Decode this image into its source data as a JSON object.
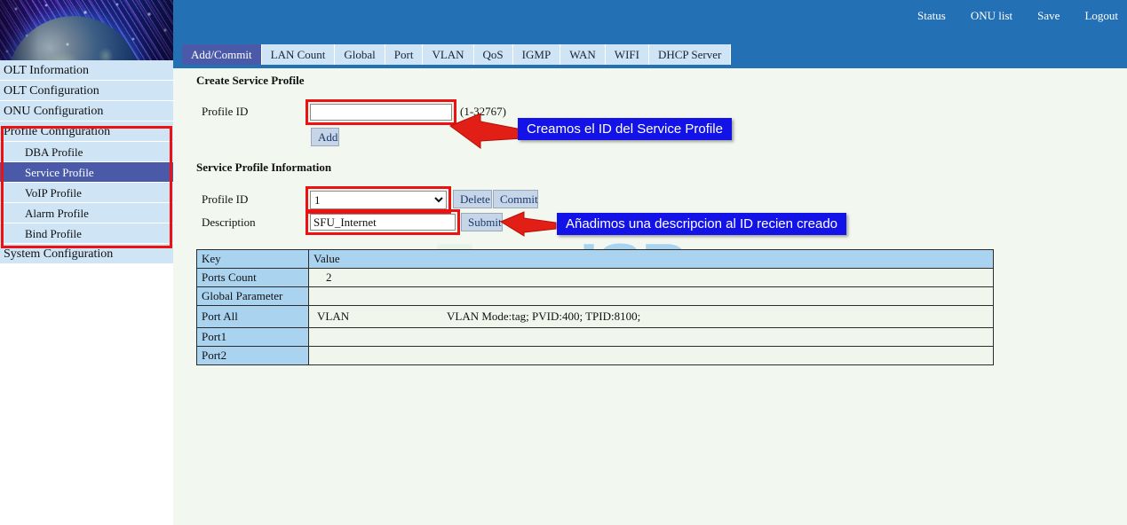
{
  "colors": {
    "header_blue": "#2470b4",
    "tab_active": "#4a5aa8",
    "tab_idle": "#cfe4f5",
    "sidebar_item": "#cfe4f5",
    "sidebar_active": "#4a5aa8",
    "content_bg": "#f2f7ef",
    "table_header": "#aad3f0",
    "annotation_red": "#ee1111",
    "callout_blue": "#1313e8"
  },
  "banner": {
    "alt": "globe-network-banner"
  },
  "sidebar": {
    "items": [
      {
        "label": "OLT Information",
        "level": 0,
        "active": false
      },
      {
        "label": "OLT Configuration",
        "level": 0,
        "active": false
      },
      {
        "label": "ONU Configuration",
        "level": 0,
        "active": false
      },
      {
        "label": "Profile Configuration",
        "level": 0,
        "active": false
      },
      {
        "label": "DBA Profile",
        "level": 1,
        "active": false
      },
      {
        "label": "Service Profile",
        "level": 1,
        "active": true
      },
      {
        "label": "VoIP Profile",
        "level": 1,
        "active": false
      },
      {
        "label": "Alarm Profile",
        "level": 1,
        "active": false
      },
      {
        "label": "Bind Profile",
        "level": 1,
        "active": false
      },
      {
        "label": "System Configuration",
        "level": 0,
        "active": false
      }
    ]
  },
  "topnav": {
    "links": [
      {
        "label": "Status"
      },
      {
        "label": "ONU list"
      },
      {
        "label": "Save"
      },
      {
        "label": "Logout"
      }
    ]
  },
  "tabs": [
    {
      "label": "Add/Commit",
      "active": true
    },
    {
      "label": "LAN Count",
      "active": false
    },
    {
      "label": "Global",
      "active": false
    },
    {
      "label": "Port",
      "active": false
    },
    {
      "label": "VLAN",
      "active": false
    },
    {
      "label": "QoS",
      "active": false
    },
    {
      "label": "IGMP",
      "active": false
    },
    {
      "label": "WAN",
      "active": false
    },
    {
      "label": "WIFI",
      "active": false
    },
    {
      "label": "DHCP Server",
      "active": false
    }
  ],
  "create_section": {
    "title": "Create Service Profile",
    "profile_id_label": "Profile ID",
    "profile_id_value": "",
    "profile_id_placeholder": "",
    "range_hint": "(1-32767)",
    "add_button": "Add"
  },
  "info_section": {
    "title": "Service Profile Information",
    "profile_id_label": "Profile ID",
    "profile_id_selected": "1",
    "profile_id_options": [
      "1"
    ],
    "delete_button": "Delete",
    "commit_button": "Commit",
    "description_label": "Description",
    "description_value": "SFU_Internet",
    "submit_button": "Submit"
  },
  "table": {
    "headers": [
      "Key",
      "Value"
    ],
    "rows": [
      {
        "key": "Ports Count",
        "value_a": "2",
        "value_b": ""
      },
      {
        "key": "Global Parameter",
        "value_a": "",
        "value_b": ""
      },
      {
        "key": "Port All",
        "value_a": "VLAN",
        "value_b": "VLAN Mode:tag; PVID:400; TPID:8100;"
      },
      {
        "key": "Port1",
        "value_a": "",
        "value_b": ""
      },
      {
        "key": "Port2",
        "value_a": "",
        "value_b": ""
      }
    ]
  },
  "annotations": {
    "callout_1": "Creamos el ID del Service Profile",
    "callout_2": "Añadimos una descripcion al ID recien creado"
  },
  "watermark": {
    "part1": "Foro",
    "part2": "ISP"
  }
}
